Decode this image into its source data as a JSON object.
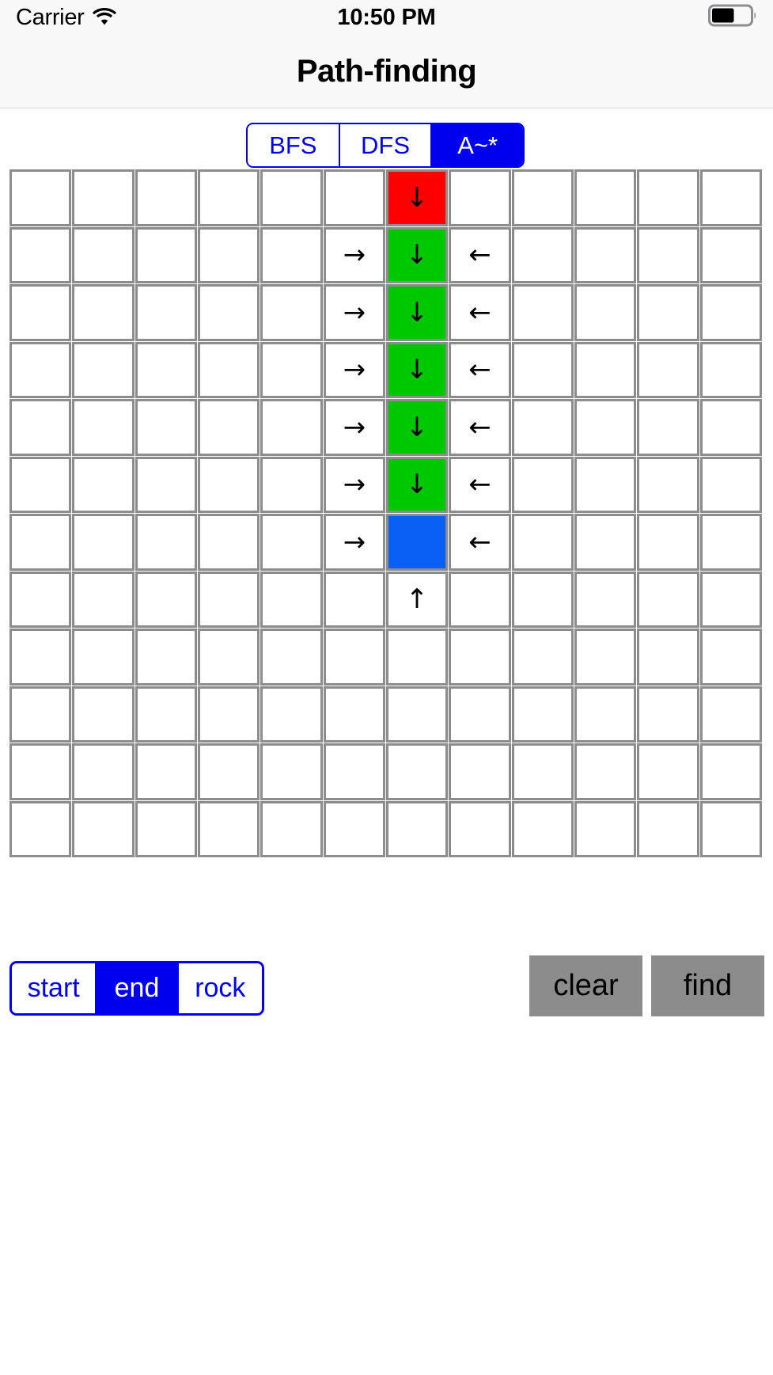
{
  "status_bar": {
    "carrier": "Carrier",
    "wifi_icon": "wifi-icon",
    "time": "10:50 PM",
    "battery_icon": "battery-icon",
    "battery_level_pct": 55
  },
  "nav_bar": {
    "title": "Path-finding"
  },
  "algorithm_segment": {
    "name": "algorithm-selector",
    "selected_index": 2,
    "options": [
      {
        "label": "BFS",
        "selected": false
      },
      {
        "label": "DFS",
        "selected": false
      },
      {
        "label": "A~*",
        "selected": true
      }
    ]
  },
  "mode_segment": {
    "name": "cell-mode-selector",
    "selected_index": 1,
    "options": [
      {
        "label": "start",
        "selected": false
      },
      {
        "label": "end",
        "selected": true
      },
      {
        "label": "rock",
        "selected": false
      }
    ]
  },
  "actions": {
    "clear_label": "clear",
    "find_label": "find"
  },
  "colors": {
    "accent_blue": "#0000ee",
    "start_red": "#ff0000",
    "path_green": "#00c800",
    "end_blue": "#0a5ff5",
    "cell_border_gray": "#8c8c8c",
    "button_gray": "#8c8c8c",
    "chrome_bg": "#f8f8f8"
  },
  "grid": {
    "rows": 12,
    "cols": 12,
    "legend": {
      "start": "start cell (red)",
      "path": "path cell (green)",
      "end": "end cell (blue)",
      "arrow_down": "↓",
      "arrow_up": "↑",
      "arrow_left": "←",
      "arrow_right": "→"
    },
    "cells": [
      [
        {
          "t": "",
          "s": ""
        },
        {
          "t": "",
          "s": ""
        },
        {
          "t": "",
          "s": ""
        },
        {
          "t": "",
          "s": ""
        },
        {
          "t": "",
          "s": ""
        },
        {
          "t": "",
          "s": ""
        },
        {
          "t": "↓",
          "s": "start"
        },
        {
          "t": "",
          "s": ""
        },
        {
          "t": "",
          "s": ""
        },
        {
          "t": "",
          "s": ""
        },
        {
          "t": "",
          "s": ""
        },
        {
          "t": "",
          "s": ""
        }
      ],
      [
        {
          "t": "",
          "s": ""
        },
        {
          "t": "",
          "s": ""
        },
        {
          "t": "",
          "s": ""
        },
        {
          "t": "",
          "s": ""
        },
        {
          "t": "",
          "s": ""
        },
        {
          "t": "→",
          "s": ""
        },
        {
          "t": "↓",
          "s": "path"
        },
        {
          "t": "←",
          "s": ""
        },
        {
          "t": "",
          "s": ""
        },
        {
          "t": "",
          "s": ""
        },
        {
          "t": "",
          "s": ""
        },
        {
          "t": "",
          "s": ""
        }
      ],
      [
        {
          "t": "",
          "s": ""
        },
        {
          "t": "",
          "s": ""
        },
        {
          "t": "",
          "s": ""
        },
        {
          "t": "",
          "s": ""
        },
        {
          "t": "",
          "s": ""
        },
        {
          "t": "→",
          "s": ""
        },
        {
          "t": "↓",
          "s": "path"
        },
        {
          "t": "←",
          "s": ""
        },
        {
          "t": "",
          "s": ""
        },
        {
          "t": "",
          "s": ""
        },
        {
          "t": "",
          "s": ""
        },
        {
          "t": "",
          "s": ""
        }
      ],
      [
        {
          "t": "",
          "s": ""
        },
        {
          "t": "",
          "s": ""
        },
        {
          "t": "",
          "s": ""
        },
        {
          "t": "",
          "s": ""
        },
        {
          "t": "",
          "s": ""
        },
        {
          "t": "→",
          "s": ""
        },
        {
          "t": "↓",
          "s": "path"
        },
        {
          "t": "←",
          "s": ""
        },
        {
          "t": "",
          "s": ""
        },
        {
          "t": "",
          "s": ""
        },
        {
          "t": "",
          "s": ""
        },
        {
          "t": "",
          "s": ""
        }
      ],
      [
        {
          "t": "",
          "s": ""
        },
        {
          "t": "",
          "s": ""
        },
        {
          "t": "",
          "s": ""
        },
        {
          "t": "",
          "s": ""
        },
        {
          "t": "",
          "s": ""
        },
        {
          "t": "→",
          "s": ""
        },
        {
          "t": "↓",
          "s": "path"
        },
        {
          "t": "←",
          "s": ""
        },
        {
          "t": "",
          "s": ""
        },
        {
          "t": "",
          "s": ""
        },
        {
          "t": "",
          "s": ""
        },
        {
          "t": "",
          "s": ""
        }
      ],
      [
        {
          "t": "",
          "s": ""
        },
        {
          "t": "",
          "s": ""
        },
        {
          "t": "",
          "s": ""
        },
        {
          "t": "",
          "s": ""
        },
        {
          "t": "",
          "s": ""
        },
        {
          "t": "→",
          "s": ""
        },
        {
          "t": "↓",
          "s": "path"
        },
        {
          "t": "←",
          "s": ""
        },
        {
          "t": "",
          "s": ""
        },
        {
          "t": "",
          "s": ""
        },
        {
          "t": "",
          "s": ""
        },
        {
          "t": "",
          "s": ""
        }
      ],
      [
        {
          "t": "",
          "s": ""
        },
        {
          "t": "",
          "s": ""
        },
        {
          "t": "",
          "s": ""
        },
        {
          "t": "",
          "s": ""
        },
        {
          "t": "",
          "s": ""
        },
        {
          "t": "→",
          "s": ""
        },
        {
          "t": "",
          "s": "end"
        },
        {
          "t": "←",
          "s": ""
        },
        {
          "t": "",
          "s": ""
        },
        {
          "t": "",
          "s": ""
        },
        {
          "t": "",
          "s": ""
        },
        {
          "t": "",
          "s": ""
        }
      ],
      [
        {
          "t": "",
          "s": ""
        },
        {
          "t": "",
          "s": ""
        },
        {
          "t": "",
          "s": ""
        },
        {
          "t": "",
          "s": ""
        },
        {
          "t": "",
          "s": ""
        },
        {
          "t": "",
          "s": ""
        },
        {
          "t": "↑",
          "s": ""
        },
        {
          "t": "",
          "s": ""
        },
        {
          "t": "",
          "s": ""
        },
        {
          "t": "",
          "s": ""
        },
        {
          "t": "",
          "s": ""
        },
        {
          "t": "",
          "s": ""
        }
      ],
      [
        {
          "t": "",
          "s": ""
        },
        {
          "t": "",
          "s": ""
        },
        {
          "t": "",
          "s": ""
        },
        {
          "t": "",
          "s": ""
        },
        {
          "t": "",
          "s": ""
        },
        {
          "t": "",
          "s": ""
        },
        {
          "t": "",
          "s": ""
        },
        {
          "t": "",
          "s": ""
        },
        {
          "t": "",
          "s": ""
        },
        {
          "t": "",
          "s": ""
        },
        {
          "t": "",
          "s": ""
        },
        {
          "t": "",
          "s": ""
        }
      ],
      [
        {
          "t": "",
          "s": ""
        },
        {
          "t": "",
          "s": ""
        },
        {
          "t": "",
          "s": ""
        },
        {
          "t": "",
          "s": ""
        },
        {
          "t": "",
          "s": ""
        },
        {
          "t": "",
          "s": ""
        },
        {
          "t": "",
          "s": ""
        },
        {
          "t": "",
          "s": ""
        },
        {
          "t": "",
          "s": ""
        },
        {
          "t": "",
          "s": ""
        },
        {
          "t": "",
          "s": ""
        },
        {
          "t": "",
          "s": ""
        }
      ],
      [
        {
          "t": "",
          "s": ""
        },
        {
          "t": "",
          "s": ""
        },
        {
          "t": "",
          "s": ""
        },
        {
          "t": "",
          "s": ""
        },
        {
          "t": "",
          "s": ""
        },
        {
          "t": "",
          "s": ""
        },
        {
          "t": "",
          "s": ""
        },
        {
          "t": "",
          "s": ""
        },
        {
          "t": "",
          "s": ""
        },
        {
          "t": "",
          "s": ""
        },
        {
          "t": "",
          "s": ""
        },
        {
          "t": "",
          "s": ""
        }
      ],
      [
        {
          "t": "",
          "s": ""
        },
        {
          "t": "",
          "s": ""
        },
        {
          "t": "",
          "s": ""
        },
        {
          "t": "",
          "s": ""
        },
        {
          "t": "",
          "s": ""
        },
        {
          "t": "",
          "s": ""
        },
        {
          "t": "",
          "s": ""
        },
        {
          "t": "",
          "s": ""
        },
        {
          "t": "",
          "s": ""
        },
        {
          "t": "",
          "s": ""
        },
        {
          "t": "",
          "s": ""
        },
        {
          "t": "",
          "s": ""
        }
      ]
    ]
  }
}
